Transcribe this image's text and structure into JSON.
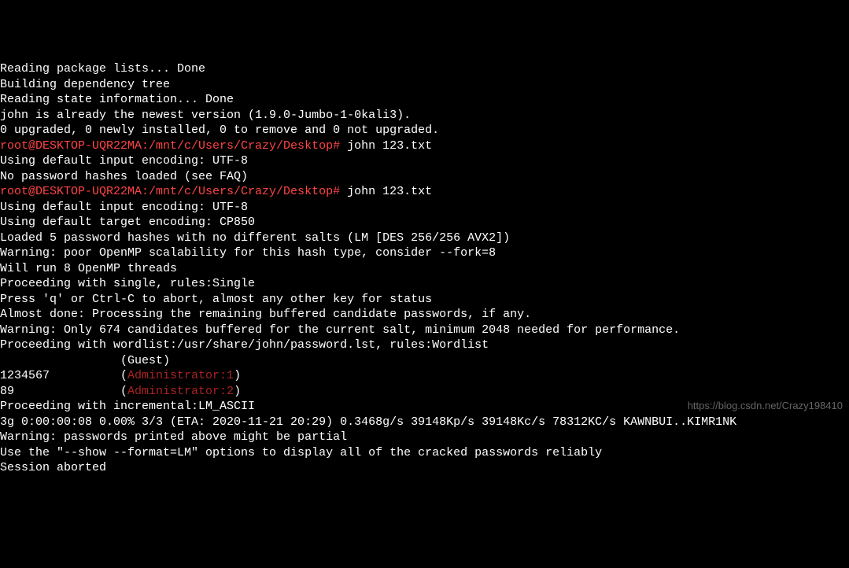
{
  "terminal": {
    "lines": [
      {
        "segments": [
          {
            "text": "Reading package lists... Done"
          }
        ]
      },
      {
        "segments": [
          {
            "text": "Building dependency tree"
          }
        ]
      },
      {
        "segments": [
          {
            "text": "Reading state information... Done"
          }
        ]
      },
      {
        "segments": [
          {
            "text": "john is already the newest version (1.9.0-Jumbo-1-0kali3)."
          }
        ]
      },
      {
        "segments": [
          {
            "text": "0 upgraded, 0 newly installed, 0 to remove and 0 not upgraded."
          }
        ]
      },
      {
        "segments": [
          {
            "text": "root@DESKTOP-UQR22MA:/mnt/c/Users/Crazy/Desktop#",
            "class": "red"
          },
          {
            "text": " john 123.txt"
          }
        ]
      },
      {
        "segments": [
          {
            "text": "Using default input encoding: UTF-8"
          }
        ]
      },
      {
        "segments": [
          {
            "text": "No password hashes loaded (see FAQ)"
          }
        ]
      },
      {
        "segments": [
          {
            "text": "root@DESKTOP-UQR22MA:/mnt/c/Users/Crazy/Desktop#",
            "class": "red"
          },
          {
            "text": " john 123.txt"
          }
        ]
      },
      {
        "segments": [
          {
            "text": "Using default input encoding: UTF-8"
          }
        ]
      },
      {
        "segments": [
          {
            "text": "Using default target encoding: CP850"
          }
        ]
      },
      {
        "segments": [
          {
            "text": "Loaded 5 password hashes with no different salts (LM [DES 256/256 AVX2])"
          }
        ]
      },
      {
        "segments": [
          {
            "text": "Warning: poor OpenMP scalability for this hash type, consider --fork=8"
          }
        ]
      },
      {
        "segments": [
          {
            "text": "Will run 8 OpenMP threads"
          }
        ]
      },
      {
        "segments": [
          {
            "text": "Proceeding with single, rules:Single"
          }
        ]
      },
      {
        "segments": [
          {
            "text": "Press 'q' or Ctrl-C to abort, almost any other key for status"
          }
        ]
      },
      {
        "segments": [
          {
            "text": "Almost done: Processing the remaining buffered candidate passwords, if any."
          }
        ]
      },
      {
        "segments": [
          {
            "text": "Warning: Only 674 candidates buffered for the current salt, minimum 2048 needed for performance."
          }
        ]
      },
      {
        "segments": [
          {
            "text": "Proceeding with wordlist:/usr/share/john/password.lst, rules:Wordlist"
          }
        ]
      },
      {
        "segments": [
          {
            "text": "                 (Guest)"
          }
        ]
      },
      {
        "segments": [
          {
            "text": "1234567          ("
          },
          {
            "text": "Administrator:1",
            "class": "darkred"
          },
          {
            "text": ")"
          }
        ]
      },
      {
        "segments": [
          {
            "text": "89               ("
          },
          {
            "text": "Administrator:2",
            "class": "darkred"
          },
          {
            "text": ")"
          }
        ]
      },
      {
        "segments": [
          {
            "text": "Proceeding with incremental:LM_ASCII"
          }
        ]
      },
      {
        "segments": [
          {
            "text": "3g 0:00:00:08 0.00% 3/3 (ETA: 2020-11-21 20:29) 0.3468g/s 39148Kp/s 39148Kc/s 78312KC/s KAWNBUI..KIMR1NK"
          }
        ]
      },
      {
        "segments": [
          {
            "text": "Warning: passwords printed above might be partial"
          }
        ]
      },
      {
        "segments": [
          {
            "text": "Use the \"--show --format=LM\" options to display all of the cracked passwords reliably"
          }
        ]
      },
      {
        "segments": [
          {
            "text": "Session aborted"
          }
        ]
      }
    ]
  },
  "watermark": "https://blog.csdn.net/Crazy198410"
}
